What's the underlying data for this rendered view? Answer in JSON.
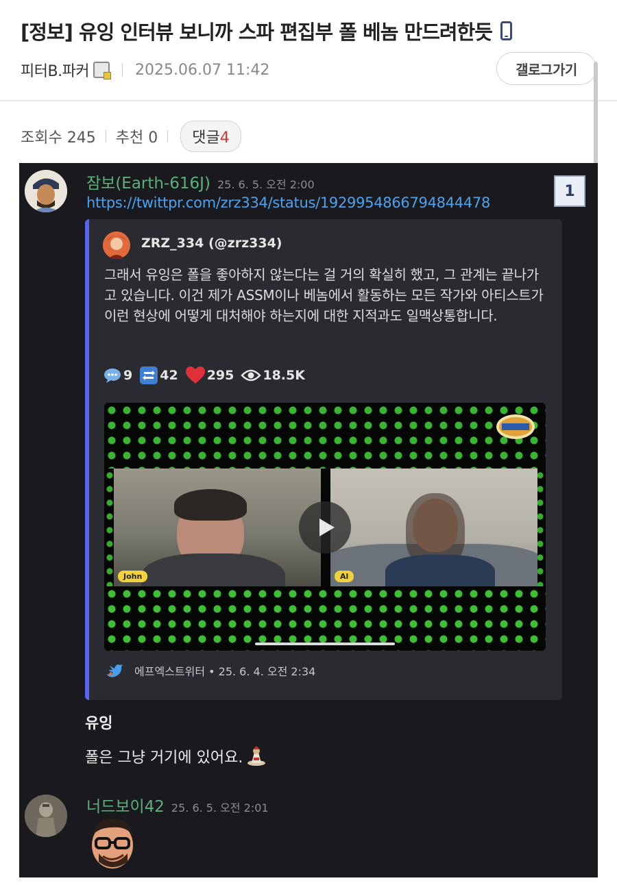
{
  "post": {
    "title": "[정보] 유잉 인터뷰 보니까 스파 편집부 폴 베놈 만드려한듯",
    "author": "피터B.파커",
    "date": "2025.06.07 11:42",
    "gallery_button": "갤로그가기"
  },
  "stats": {
    "views_label": "조회수 245",
    "likes_label": "추천 0",
    "comments_label": "댓글",
    "comments_count": "4"
  },
  "comment1": {
    "name": "잠보(Earth-616J)",
    "time": "25. 6. 5. 오전 2:00",
    "link": "https://twittpr.com/zrz334/status/1929954866794844478",
    "number": "1"
  },
  "embed": {
    "author": "ZRZ_334 (@zrz334)",
    "text": "그래서 유잉은 폴을 좋아하지 않는다는 걸 거의 확실히 했고, 그 관계는 끝나가고 있습니다. 이건 제가 ASSM이나 베놈에서 활동하는 모든 작가와 아티스트가 이런 현상에 어떻게 대처해야 하는지에 대한 지적과도 일맥상통합니다.",
    "replies": "9",
    "retweets": "42",
    "likes": "295",
    "views": "18.5K",
    "video": {
      "left_tag": "John",
      "right_tag": "Al"
    },
    "footer": "에프엑스트위터 • 25. 6. 4. 오전 2:34"
  },
  "reply": {
    "name": "유잉",
    "text": "폴은 그냥 거기에 있어요."
  },
  "comment2": {
    "name": "너드보이42",
    "time": "25. 6. 5. 오전 2:01"
  },
  "colors": {
    "username_green": "#5ab27a",
    "link_blue": "#4ba3f0",
    "embed_accent": "#5865f2",
    "comment_count_red": "#d0362f"
  },
  "icons": [
    "phone-icon",
    "user-badge-icon",
    "speech-bubble-icon",
    "retweet-icon",
    "heart-icon",
    "eye-icon",
    "play-icon",
    "twitter-bird-icon"
  ]
}
